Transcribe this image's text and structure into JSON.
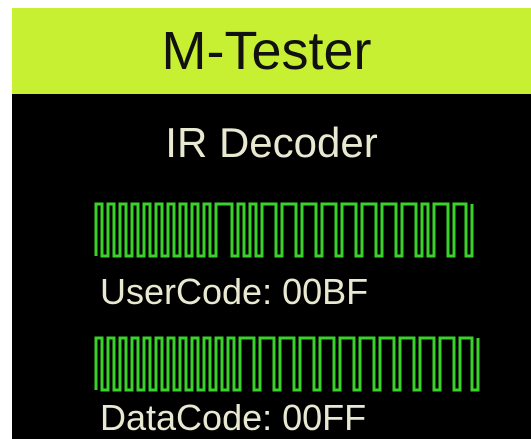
{
  "app": {
    "title": "M-Tester"
  },
  "screen": {
    "subtitle": "IR Decoder",
    "user_code_text": "UserCode: 00BF",
    "data_code_text": "DataCode: 00FF"
  },
  "colors": {
    "title_bar": "#c8f032",
    "display_background": "#000000",
    "waveform": "#3ad22a",
    "text": "#e9e9d2"
  }
}
